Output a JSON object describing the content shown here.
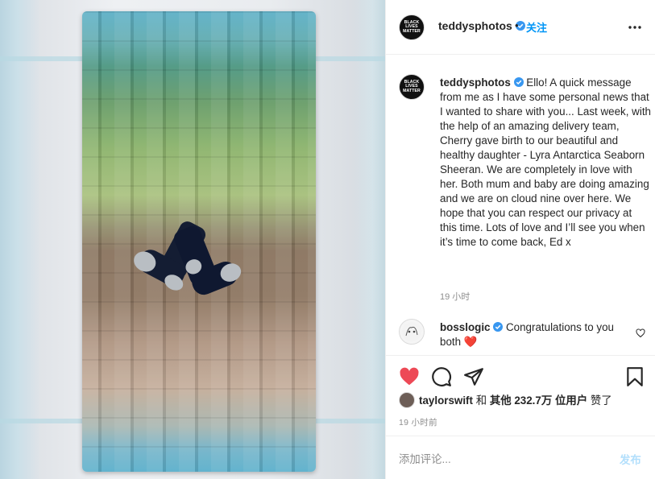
{
  "post_image": {
    "description_icon": "photo-knitted-blanket-with-socks"
  },
  "header": {
    "username": "teddysphotos",
    "verified_icon": "verified-badge-icon",
    "separator": "•",
    "follow_label": "关注",
    "more_icon": "more-horizontal-icon",
    "avatar_lines": [
      "BLACK",
      "LIVES",
      "MATTER"
    ]
  },
  "caption": {
    "username": "teddysphotos",
    "text": "Ello! A quick message from me as I have some personal news that I wanted to share with you... Last week, with the help of an amazing delivery team, Cherry gave birth to our beautiful and healthy daughter - Lyra Antarctica Seaborn Sheeran. We are completely in love with her. Both mum and baby are doing amazing and we are on cloud nine over here. We hope that you can respect our privacy at this time. Lots of love and I’ll see you when it’s time to come back, Ed x",
    "time": "19 小时"
  },
  "comments": [
    {
      "username": "bosslogic",
      "text": "Congratulations to you both",
      "emoji": "❤️"
    }
  ],
  "actions": {
    "like_icon": "heart-filled-icon",
    "comment_icon": "comment-icon",
    "share_icon": "paper-plane-icon",
    "save_icon": "bookmark-icon"
  },
  "likes": {
    "first_user": "taylorswift",
    "connector": "和",
    "others_label": "其他 232.7万 位用户",
    "suffix": "赞了"
  },
  "post_time": "19 小时前",
  "add_comment": {
    "placeholder": "添加评论...",
    "post_label": "发布"
  },
  "colors": {
    "accent": "#0095f6",
    "like_red": "#ed4956",
    "post_disabled": "#b2dffc",
    "muted": "#8e8e8e"
  }
}
